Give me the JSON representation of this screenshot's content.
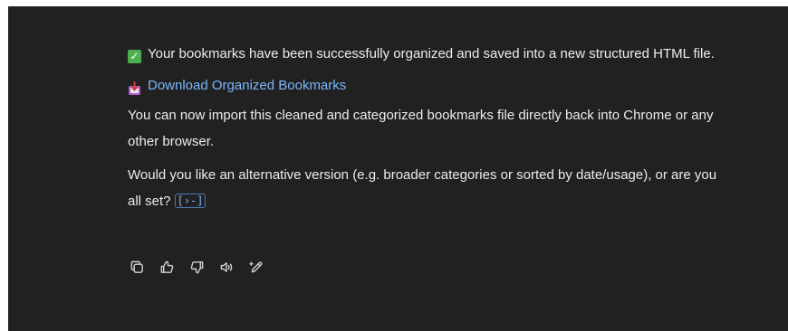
{
  "message": {
    "paragraph1": "Your bookmarks have been successfully organized and saved into a new structured HTML file.",
    "check_glyph": "✓",
    "download_link": "Download Organized Bookmarks",
    "paragraph2": "You can now import this cleaned and categorized bookmarks file directly back into Chrome or any other browser.",
    "paragraph3": "Would you like an alternative version (e.g. broader categories or sorted by date/usage), or are you all set?",
    "cite_glyph": "[›-]"
  },
  "actions": {
    "icons": [
      "copy-icon",
      "thumbs-up-icon",
      "thumbs-down-icon",
      "read-aloud-icon",
      "edit-icon"
    ]
  },
  "colors": {
    "background": "#212121",
    "text": "#ececec",
    "link": "#7ab7ff",
    "check": "#4caf50"
  }
}
